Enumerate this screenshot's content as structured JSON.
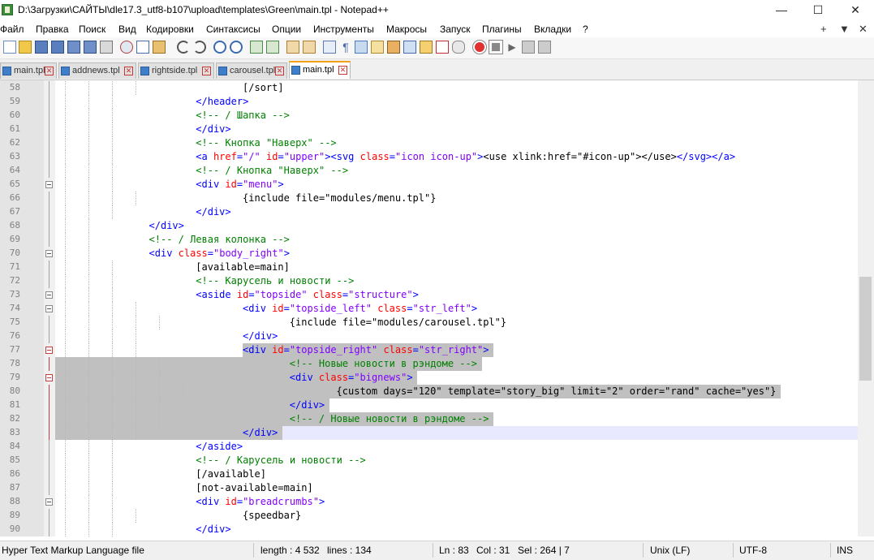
{
  "window": {
    "title": "D:\\Загрузки\\САЙТЫ\\dle17.3_utf8-b107\\upload\\templates\\Green\\main.tpl - Notepad++",
    "minimize": "—",
    "maximize": "☐",
    "close": "✕"
  },
  "menu": {
    "items": [
      "Файл",
      "Правка",
      "Поиск",
      "Вид",
      "Кодировки",
      "Синтаксисы",
      "Опции",
      "Инструменты",
      "Макросы",
      "Запуск",
      "Плагины",
      "Вкладки",
      "?"
    ],
    "right": [
      "+",
      "▼",
      "✕"
    ]
  },
  "toolbar": {
    "icons": [
      "new-file",
      "open-file",
      "save",
      "save-all",
      "close",
      "close-all",
      "print",
      "cut",
      "copy",
      "paste",
      "undo",
      "redo",
      "find",
      "replace",
      "zoom-in",
      "zoom-out",
      "sync-v",
      "sync-h",
      "word-wrap",
      "show-all-chars",
      "indent-guide",
      "udl",
      "doc-map",
      "function-list",
      "folder-workspace",
      "monitor",
      "record-macro",
      "stop-macro",
      "play-macro",
      "run-macro-multiple",
      "save-macro"
    ]
  },
  "tabs": [
    {
      "label": "main.tpl",
      "active": false
    },
    {
      "label": "addnews.tpl",
      "active": false
    },
    {
      "label": "rightside.tpl",
      "active": false
    },
    {
      "label": "carousel.tpl",
      "active": false
    },
    {
      "label": "main.tpl",
      "active": true
    }
  ],
  "editor": {
    "lines": [
      {
        "n": "58",
        "indent": 8,
        "parts": [
          [
            "txt",
            "[/sort]"
          ]
        ]
      },
      {
        "n": "59",
        "indent": 6,
        "parts": [
          [
            "tag",
            "</header>"
          ]
        ]
      },
      {
        "n": "60",
        "indent": 6,
        "parts": [
          [
            "com",
            "<!-- / Шапка -->"
          ]
        ]
      },
      {
        "n": "61",
        "indent": 6,
        "parts": [
          [
            "tag",
            "</div>"
          ]
        ]
      },
      {
        "n": "62",
        "indent": 6,
        "parts": [
          [
            "com",
            "<!-- Кнопка \"Наверх\" -->"
          ]
        ]
      },
      {
        "n": "63",
        "indent": 6,
        "parts": [
          [
            "tag",
            "<a "
          ],
          [
            "attr",
            "href"
          ],
          [
            "tag",
            "="
          ],
          [
            "val",
            "\"/\""
          ],
          [
            "tag",
            " "
          ],
          [
            "attr",
            "id"
          ],
          [
            "tag",
            "="
          ],
          [
            "val",
            "\"upper\""
          ],
          [
            "tag",
            "><svg "
          ],
          [
            "attr",
            "class"
          ],
          [
            "tag",
            "="
          ],
          [
            "val",
            "\"icon icon-up\""
          ],
          [
            "tag",
            ">"
          ],
          [
            "txt",
            "<use xlink:href=\"#icon-up\"></use>"
          ],
          [
            "tag",
            "</svg></a>"
          ]
        ]
      },
      {
        "n": "64",
        "indent": 6,
        "parts": [
          [
            "com",
            "<!-- / Кнопка \"Наверх\" -->"
          ]
        ]
      },
      {
        "n": "65",
        "indent": 6,
        "parts": [
          [
            "tag",
            "<div "
          ],
          [
            "attr",
            "id"
          ],
          [
            "tag",
            "="
          ],
          [
            "val",
            "\"menu\""
          ],
          [
            "tag",
            ">"
          ]
        ]
      },
      {
        "n": "66",
        "indent": 8,
        "parts": [
          [
            "txt",
            "{include file=\"modules/menu.tpl\"}"
          ]
        ]
      },
      {
        "n": "67",
        "indent": 6,
        "parts": [
          [
            "tag",
            "</div>"
          ]
        ]
      },
      {
        "n": "68",
        "indent": 4,
        "parts": [
          [
            "tag",
            "</div>"
          ]
        ]
      },
      {
        "n": "69",
        "indent": 4,
        "parts": [
          [
            "com",
            "<!-- / Левая колонка -->"
          ]
        ]
      },
      {
        "n": "70",
        "indent": 4,
        "parts": [
          [
            "tag",
            "<div "
          ],
          [
            "attr",
            "class"
          ],
          [
            "tag",
            "="
          ],
          [
            "val",
            "\"body_right\""
          ],
          [
            "tag",
            ">"
          ]
        ]
      },
      {
        "n": "71",
        "indent": 6,
        "parts": [
          [
            "txt",
            "[available=main]"
          ]
        ]
      },
      {
        "n": "72",
        "indent": 6,
        "parts": [
          [
            "com",
            "<!-- Карусель и новости -->"
          ]
        ]
      },
      {
        "n": "73",
        "indent": 6,
        "parts": [
          [
            "tag",
            "<aside "
          ],
          [
            "attr",
            "id"
          ],
          [
            "tag",
            "="
          ],
          [
            "val",
            "\"topside\""
          ],
          [
            "tag",
            " "
          ],
          [
            "attr",
            "class"
          ],
          [
            "tag",
            "="
          ],
          [
            "val",
            "\"structure\""
          ],
          [
            "tag",
            ">"
          ]
        ]
      },
      {
        "n": "74",
        "indent": 8,
        "parts": [
          [
            "tag",
            "<div "
          ],
          [
            "attr",
            "id"
          ],
          [
            "tag",
            "="
          ],
          [
            "val",
            "\"topside_left\""
          ],
          [
            "tag",
            " "
          ],
          [
            "attr",
            "class"
          ],
          [
            "tag",
            "="
          ],
          [
            "val",
            "\"str_left\""
          ],
          [
            "tag",
            ">"
          ]
        ]
      },
      {
        "n": "75",
        "indent": 10,
        "parts": [
          [
            "txt",
            "{include file=\"modules/carousel.tpl\"}"
          ]
        ]
      },
      {
        "n": "76",
        "indent": 8,
        "parts": [
          [
            "tag",
            "</div>"
          ]
        ]
      },
      {
        "n": "77",
        "indent": 8,
        "parts": [
          [
            "tag",
            "<div "
          ],
          [
            "attr",
            "id"
          ],
          [
            "tag",
            "="
          ],
          [
            "val",
            "\"topside_right\""
          ],
          [
            "tag",
            " "
          ],
          [
            "attr",
            "class"
          ],
          [
            "tag",
            "="
          ],
          [
            "val",
            "\"str_right\""
          ],
          [
            "tag",
            ">"
          ]
        ]
      },
      {
        "n": "78",
        "indent": 10,
        "parts": [
          [
            "com",
            "<!-- Новые новости в рэндоме -->"
          ]
        ]
      },
      {
        "n": "79",
        "indent": 10,
        "parts": [
          [
            "tag",
            "<div "
          ],
          [
            "attr",
            "class"
          ],
          [
            "tag",
            "="
          ],
          [
            "val",
            "\"bignews\""
          ],
          [
            "tag",
            ">"
          ]
        ]
      },
      {
        "n": "80",
        "indent": 12,
        "parts": [
          [
            "txt",
            "{custom days=\"120\" template=\"story_big\" limit=\"2\" order=\"rand\" cache=\"yes\"}"
          ]
        ]
      },
      {
        "n": "81",
        "indent": 10,
        "parts": [
          [
            "tag",
            "</div>"
          ]
        ]
      },
      {
        "n": "82",
        "indent": 10,
        "parts": [
          [
            "com",
            "<!-- / Новые новости в рэндоме -->"
          ]
        ]
      },
      {
        "n": "83",
        "indent": 8,
        "parts": [
          [
            "tag",
            "</div>"
          ]
        ]
      },
      {
        "n": "84",
        "indent": 6,
        "parts": [
          [
            "tag",
            "</aside>"
          ]
        ]
      },
      {
        "n": "85",
        "indent": 6,
        "parts": [
          [
            "com",
            "<!-- / Карусель и новости -->"
          ]
        ]
      },
      {
        "n": "86",
        "indent": 6,
        "parts": [
          [
            "txt",
            "[/available]"
          ]
        ]
      },
      {
        "n": "87",
        "indent": 6,
        "parts": [
          [
            "txt",
            "[not-available=main]"
          ]
        ]
      },
      {
        "n": "88",
        "indent": 6,
        "parts": [
          [
            "tag",
            "<div "
          ],
          [
            "attr",
            "id"
          ],
          [
            "tag",
            "="
          ],
          [
            "val",
            "\"breadcrumbs\""
          ],
          [
            "tag",
            ">"
          ]
        ]
      },
      {
        "n": "89",
        "indent": 8,
        "parts": [
          [
            "txt",
            "{speedbar}"
          ]
        ]
      },
      {
        "n": "90",
        "indent": 6,
        "parts": [
          [
            "tag",
            "</div>"
          ]
        ]
      }
    ]
  },
  "status": {
    "language": "Hyper Text Markup Language file",
    "length": "length : 4 532",
    "lines": "lines : 134",
    "ln": "Ln : 83",
    "col": "Col : 31",
    "sel": "Sel : 264 | 7",
    "eol": "Unix (LF)",
    "encoding": "UTF-8",
    "mode": "INS"
  }
}
